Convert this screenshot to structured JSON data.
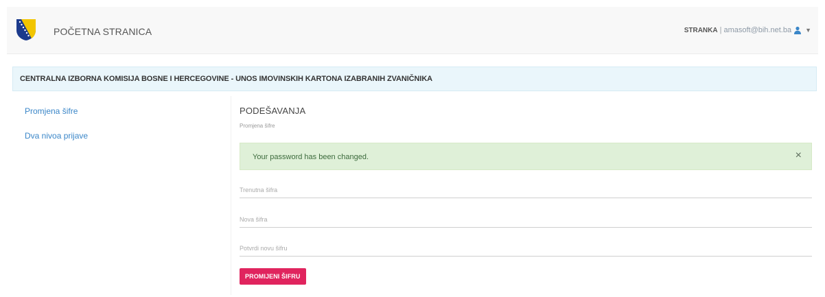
{
  "navbar": {
    "home_label": "POČETNA STRANICA",
    "user_role": "STRANKA",
    "separator": "|",
    "user_email": "amasoft@bih.net.ba",
    "user_icon": "user-icon",
    "dropdown_icon": "caret-down-icon",
    "logo": "coat-of-arms-logo"
  },
  "banner": {
    "title": "CENTRALNA IZBORNA KOMISIJA BOSNE I HERCEGOVINE - UNOS IMOVINSKIH KARTONA IZABRANIH ZVANIČNIKA"
  },
  "sidebar": {
    "items": [
      {
        "label": "Promjena šifre"
      },
      {
        "label": "Dva nivoa prijave"
      }
    ]
  },
  "main": {
    "title": "PODEŠAVANJA",
    "subtitle": "Promjena šifre",
    "alert": {
      "message": "Your password has been changed.",
      "close_symbol": "×"
    },
    "fields": [
      {
        "placeholder": "Trenutna šifra",
        "value": ""
      },
      {
        "placeholder": "Nova šifra",
        "value": ""
      },
      {
        "placeholder": "Potvrdi novu šifru",
        "value": ""
      }
    ],
    "submit_label": "PROMIJENI ŠIFRU"
  },
  "colors": {
    "accent_button": "#e0245e",
    "link": "#3a86c8",
    "alert_bg": "#dff0d8",
    "banner_bg": "#eaf6fb"
  }
}
